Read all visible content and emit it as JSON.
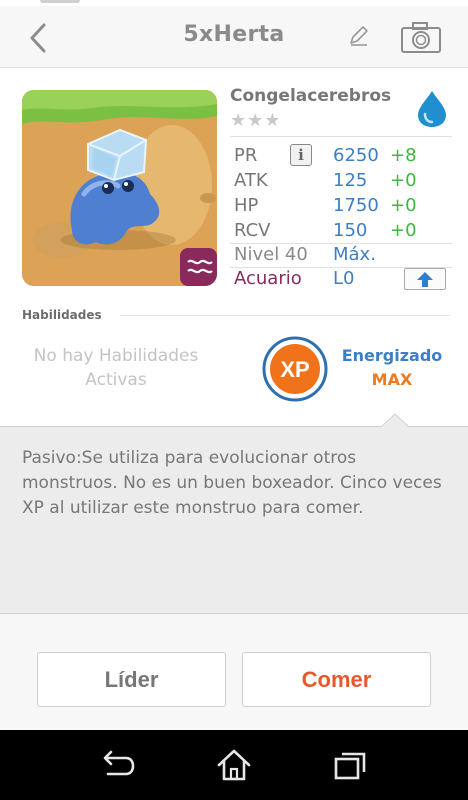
{
  "header": {
    "title": "5xHerta"
  },
  "monster": {
    "name": "Congelacerebros",
    "stars": "★★★",
    "element_icon": "water-drop-icon",
    "badge_icon": "wave-symbol-icon",
    "stats": [
      {
        "label": "PR",
        "value": "6250",
        "bonus": "+8"
      },
      {
        "label": "ATK",
        "value": "125",
        "bonus": "+0"
      },
      {
        "label": "HP",
        "value": "1750",
        "bonus": "+0"
      },
      {
        "label": "RCV",
        "value": "150",
        "bonus": "+0"
      }
    ],
    "info_icon_glyph": "i",
    "level_label": "Nivel 40",
    "level_value": "Máx.",
    "type_label": "Acuario",
    "type_level": "L0"
  },
  "skills": {
    "heading": "Habilidades",
    "empty_text": "No hay Habilidades Activas",
    "badge_text": "XP",
    "energized_label": "Energizado",
    "energized_value": "MAX"
  },
  "passive": {
    "text": "Pasivo:Se utiliza para evolucionar otros monstruos. No es un buen boxeador. Cinco veces XP al utilizar este monstruo para comer."
  },
  "actions": {
    "leader_label": "Líder",
    "eat_label": "Comer"
  },
  "colors": {
    "accent_blue": "#3d7fc4",
    "bonus_green": "#3fb63f",
    "eat_orange": "#e8582e",
    "max_orange": "#f07a1c",
    "type_purple": "#8a2a5c"
  }
}
